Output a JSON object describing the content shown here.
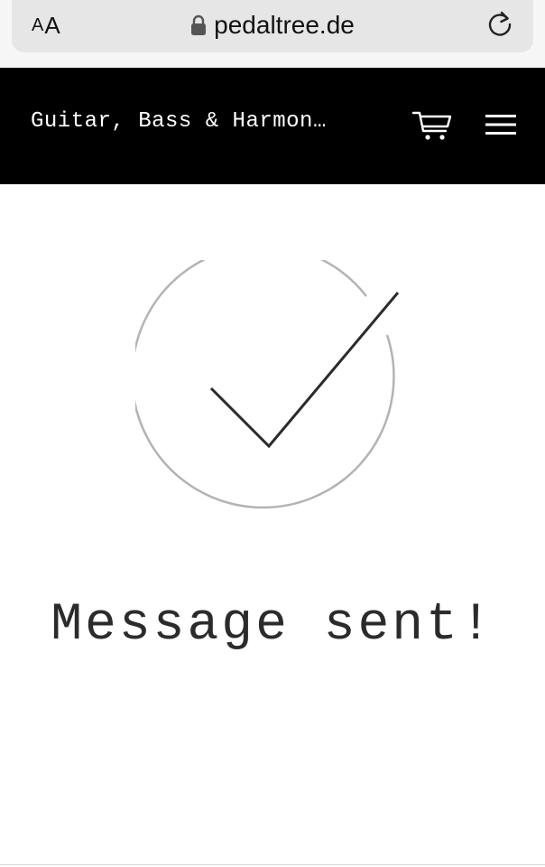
{
  "browser": {
    "text_size_small": "A",
    "text_size_big": "A",
    "url": "pedaltree.de",
    "icons": [
      "lock-icon",
      "reload-icon"
    ]
  },
  "header": {
    "title": "Guitar, Bass & Harmon…",
    "icons": [
      "cart-icon",
      "menu-icon"
    ]
  },
  "main": {
    "message": "Message sent!",
    "icon": "check-circle-icon"
  },
  "colors": {
    "header_bg": "#000000",
    "header_text": "#ffffff",
    "circle_stroke": "#b3b3b3",
    "check_stroke": "#2b2b2b",
    "message_text": "#2b2b2b"
  }
}
